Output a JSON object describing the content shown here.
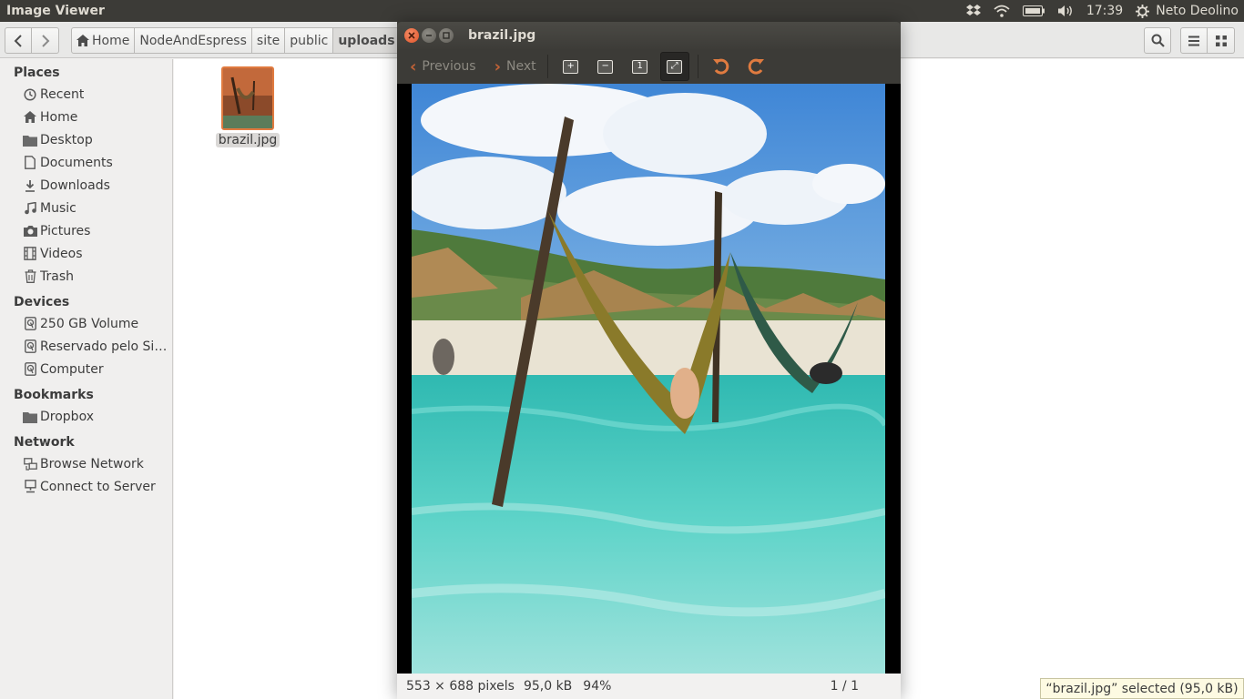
{
  "top_panel": {
    "app_title": "Image Viewer",
    "clock": "17:39",
    "user": "Neto Deolino",
    "icons": [
      "dropbox-icon",
      "wifi-icon",
      "battery-icon",
      "volume-icon",
      "power-gear-icon"
    ]
  },
  "file_manager": {
    "breadcrumbs": [
      {
        "label": "Home",
        "icon": "home-icon"
      },
      {
        "label": "NodeAndEspress"
      },
      {
        "label": "site"
      },
      {
        "label": "public"
      },
      {
        "label": "uploads",
        "active": true
      }
    ],
    "sidebar": {
      "sections": [
        {
          "title": "Places",
          "items": [
            {
              "label": "Recent",
              "icon": "clock-icon"
            },
            {
              "label": "Home",
              "icon": "home-icon"
            },
            {
              "label": "Desktop",
              "icon": "folder-icon"
            },
            {
              "label": "Documents",
              "icon": "document-icon"
            },
            {
              "label": "Downloads",
              "icon": "download-icon"
            },
            {
              "label": "Music",
              "icon": "music-icon"
            },
            {
              "label": "Pictures",
              "icon": "camera-icon"
            },
            {
              "label": "Videos",
              "icon": "film-icon"
            },
            {
              "label": "Trash",
              "icon": "trash-icon"
            }
          ]
        },
        {
          "title": "Devices",
          "items": [
            {
              "label": "250 GB Volume",
              "icon": "drive-icon"
            },
            {
              "label": "Reservado pelo Sis…",
              "icon": "drive-icon"
            },
            {
              "label": "Computer",
              "icon": "drive-icon"
            }
          ]
        },
        {
          "title": "Bookmarks",
          "items": [
            {
              "label": "Dropbox",
              "icon": "folder-icon"
            }
          ]
        },
        {
          "title": "Network",
          "items": [
            {
              "label": "Browse Network",
              "icon": "network-icon"
            },
            {
              "label": "Connect to Server",
              "icon": "server-icon"
            }
          ]
        }
      ]
    },
    "files": [
      {
        "name": "brazil.jpg",
        "selected": true
      }
    ],
    "status": "“brazil.jpg” selected  (95,0 kB)"
  },
  "viewer": {
    "title": "brazil.jpg",
    "toolbar": {
      "previous_label": "Previous",
      "next_label": "Next"
    },
    "status": {
      "dimensions": "553 × 688 pixels",
      "size": "95,0 kB",
      "zoom": "94%",
      "position": "1 / 1"
    }
  },
  "colors": {
    "panel_bg": "#3c3b37",
    "accent_orange": "#e07b40",
    "status_yellow": "#fdfae2"
  }
}
